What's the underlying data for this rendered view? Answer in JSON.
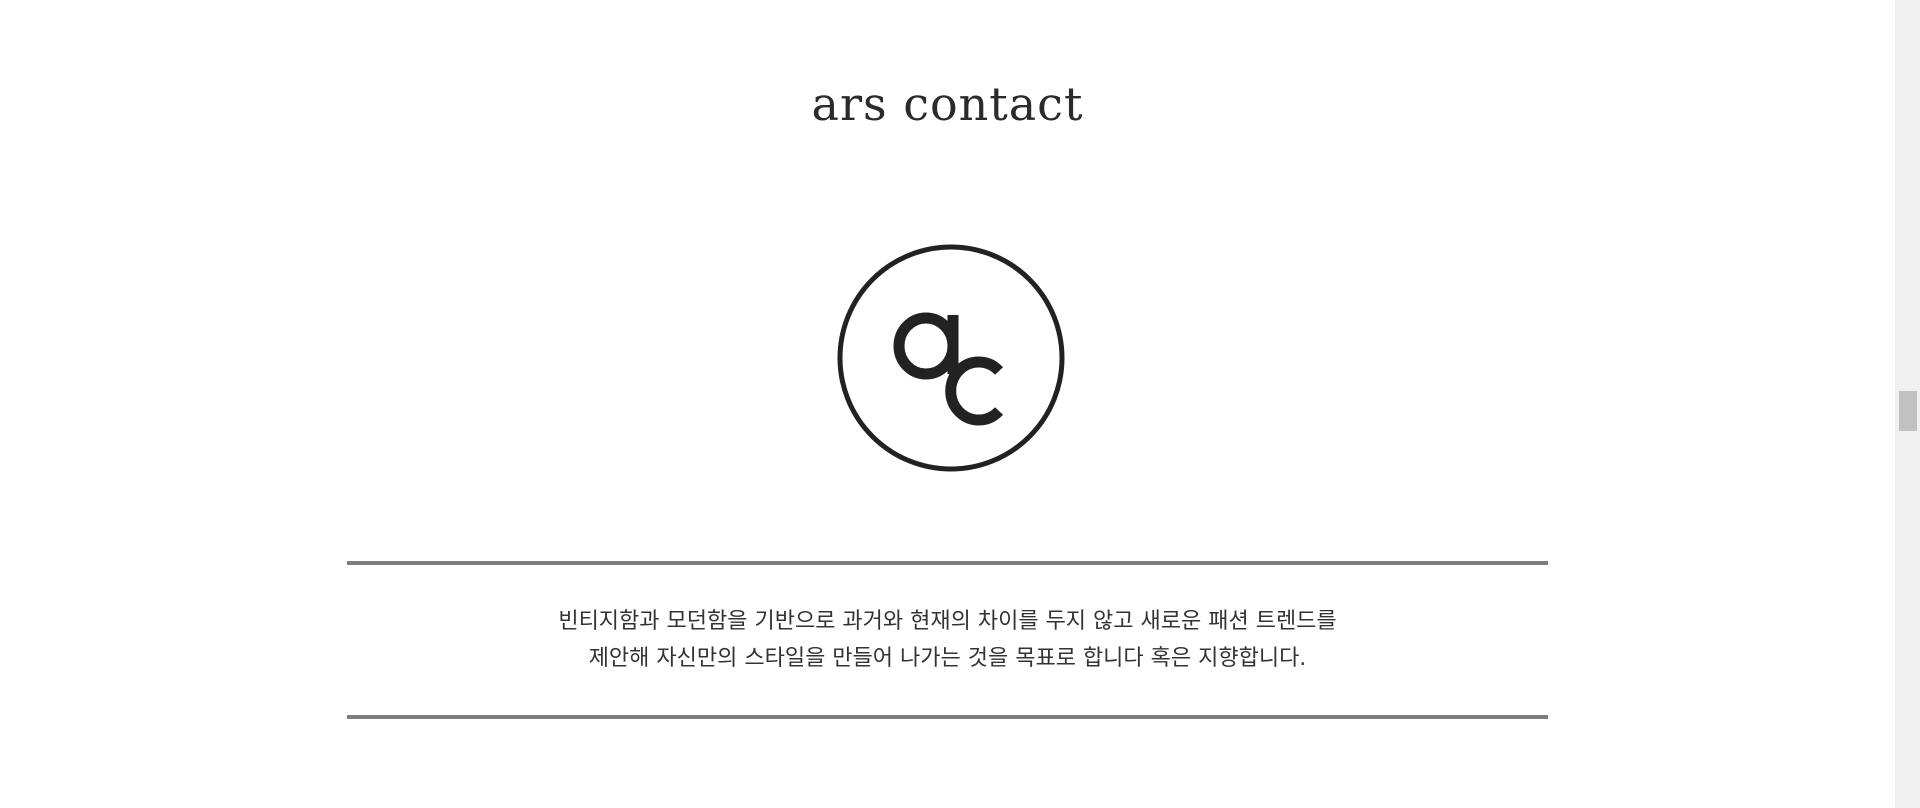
{
  "page": {
    "title": "ars contact",
    "logo": {
      "icon": "ac-circle-logo-icon",
      "letters": "ac"
    },
    "intro": {
      "line1": "빈티지함과 모던함을 기반으로 과거와 현재의 차이를 두지 않고 새로운 패션 트렌드를",
      "line2": "제안해 자신만의 스타일을 만들어 나가는 것을 목표로 합니다 혹은 지향합니다."
    }
  },
  "colors": {
    "text": "#2b2b2b",
    "divider": "#7d7d7d",
    "background": "#ffffff",
    "scrollbar_track": "#f1f1f1",
    "scrollbar_thumb": "#c1c1c1"
  },
  "scrollbar": {
    "position_fraction": 0.48
  }
}
